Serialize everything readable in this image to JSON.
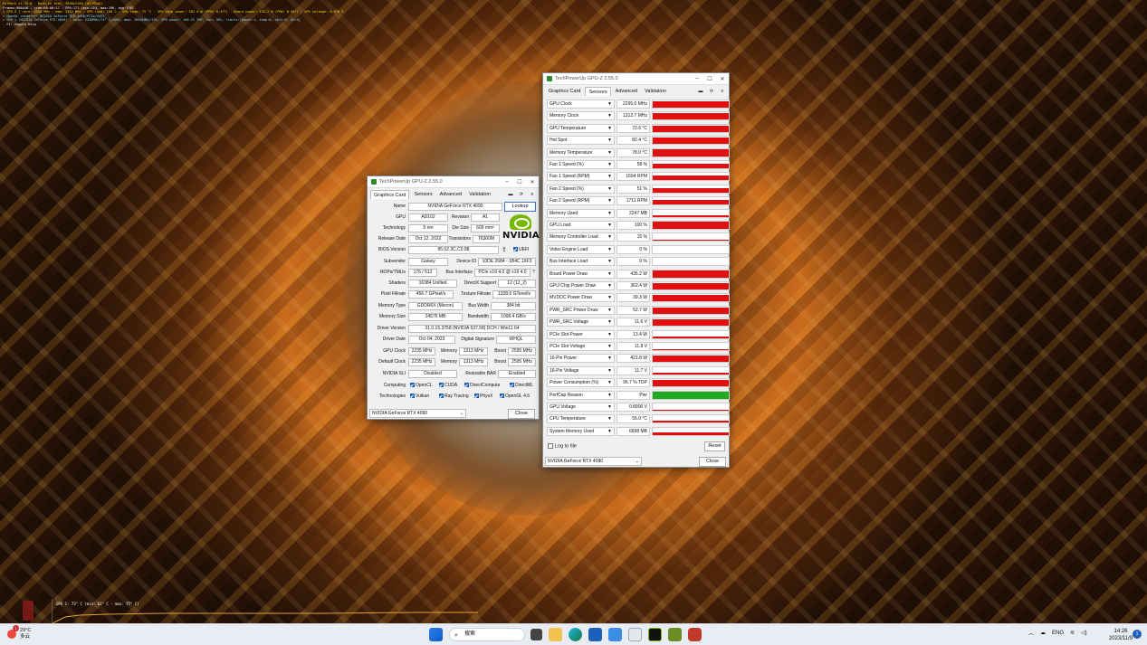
{
  "osd": {
    "lines": [
      "FurMark v1.35.0 - Burn-in test, 3840x2160 (0X MSAA)",
      "Frames:906448 - time:00:00:17 - FPS:177 (min:154, max:196, avg:176)",
      "[ GPU-Z ] core: 2250 MHz - mem: 1312 MHz - GPU load: 100 % - GPU temp: 73 °C - GPU chip power: 362.4 W (PPW: 0.477) - Board power: 435.2 W (PPW: 0.407) - GPU voltage: 0.870 V",
      "> OpenGL renderer: NVIDIA GeForce RTX 4090/PCIe/SSE2",
      "> GPU 1 (NVIDIA GeForce RTX 4090) - core: 2250MHz/74° C/100%, mem: 10501MHz/15%, GPU power: 100.2% TDP, fan: 58%, limits:[power:1, temp:0, volt:0, OV:0]",
      "- F1: toggle help"
    ]
  },
  "graph": {
    "label": "GPU 1: 73° C (min: 61° C - max: 75° C)"
  },
  "gc_window": {
    "title": "TechPowerUp GPU-Z 2.55.0",
    "tabs": [
      "Graphics Card",
      "Sensors",
      "Advanced",
      "Validation"
    ],
    "lookup": "Lookup",
    "logo_text": "NVIDIA",
    "uefi": "UEFI",
    "fields": {
      "name_l": "Name",
      "name": "NVIDIA GeForce RTX 4090",
      "gpu_l": "GPU",
      "gpu": "AD102",
      "rev_l": "Revision",
      "rev": "A1",
      "tech_l": "Technology",
      "tech": "5 nm",
      "die_l": "Die Size",
      "die": "609 mm²",
      "rel_l": "Release Date",
      "rel": "Oct 12, 2022",
      "trans_l": "Transistors",
      "trans": "76300M",
      "bios_l": "BIOS Version",
      "bios": "95.02.3C.C0.88",
      "subv_l": "Subvendor",
      "subv": "Galaxy",
      "dev_l": "Device ID",
      "dev": "10DE 2684 - 1B4C 16F3",
      "rops_l": "ROPs/TMUs",
      "rops": "176 / 512",
      "bus_l": "Bus Interface",
      "bus": "PCIe x16 4.0 @ x16 4.0",
      "q": "?",
      "shad_l": "Shaders",
      "shad": "16384 Unified",
      "dx_l": "DirectX Support",
      "dx": "12 (12_2)",
      "pix_l": "Pixel Fillrate",
      "pix": "456.7 GPixel/s",
      "tex_l": "Texture Fillrate",
      "tex": "1328.6 GTexel/s",
      "mt_l": "Memory Type",
      "mt": "GDDR6X (Micron)",
      "bw_l": "Bus Width",
      "bw": "384 bit",
      "ms_l": "Memory Size",
      "ms": "24576 MB",
      "band_l": "Bandwidth",
      "band": "1008.4 GB/s",
      "drv_l": "Driver Version",
      "drv": "31.0.15.3758 (NVIDIA 537.58) DCH / Win11 64",
      "dd_l": "Driver Date",
      "dd": "Oct 04, 2023",
      "sig_l": "Digital Signature",
      "sig": "WHQL",
      "gclk_l": "GPU Clock",
      "gclk": "2235 MHz",
      "mem_l": "Memory",
      "mem": "1313 MHz",
      "boost_l": "Boost",
      "boost": "2595 MHz",
      "dclk_l": "Default Clock",
      "dclk": "2235 MHz",
      "dmem": "1313 MHz",
      "dboost": "2595 MHz",
      "sli_l": "NVIDIA SLI",
      "sli": "Disabled",
      "rbar_l": "Resizable BAR",
      "rbar": "Enabled",
      "comp_l": "Computing",
      "opencl": "OpenCL",
      "cuda": "CUDA",
      "dcomp": "DirectCompute",
      "dml": "DirectML",
      "techs_l": "Technologies",
      "vulkan": "Vulkan",
      "rt": "Ray Tracing",
      "physx": "PhysX",
      "ogl": "OpenGL 4.6"
    },
    "device_select": "NVIDIA GeForce RTX 4090",
    "close": "Close"
  },
  "sn_window": {
    "title": "TechPowerUp GPU-Z 2.55.0",
    "tabs": [
      "Graphics Card",
      "Sensors",
      "Advanced",
      "Validation"
    ],
    "sensors": [
      {
        "name": "GPU Clock",
        "value": "2295.0 MHz",
        "level": 0.9
      },
      {
        "name": "Memory Clock",
        "value": "1312.7 MHz",
        "level": 0.9
      },
      {
        "name": "GPU Temperature",
        "value": "72.6 °C",
        "level": 0.9
      },
      {
        "name": "Hot Spot",
        "value": "82.4 °C",
        "level": 0.9
      },
      {
        "name": "Memory Temperature",
        "value": "78.0 °C",
        "level": 0.9
      },
      {
        "name": "Fan 1 Speed (%)",
        "value": "58 %",
        "level": 0.65
      },
      {
        "name": "Fan 1 Speed (RPM)",
        "value": "1694 RPM",
        "level": 0.65
      },
      {
        "name": "Fan 2 Speed (%)",
        "value": "51 %",
        "level": 0.6
      },
      {
        "name": "Fan 2 Speed (RPM)",
        "value": "1711 RPM",
        "level": 0.6
      },
      {
        "name": "Memory Used",
        "value": "2247 MB",
        "level": 0.1
      },
      {
        "name": "GPU Load",
        "value": "100 %",
        "level": 0.95
      },
      {
        "name": "Memory Controller Load",
        "value": "15 %",
        "level": 0.15
      },
      {
        "name": "Video Engine Load",
        "value": "0 %",
        "level": 0
      },
      {
        "name": "Bus Interface Load",
        "value": "0 %",
        "level": 0
      },
      {
        "name": "Board Power Draw",
        "value": "435.2 W",
        "level": 0.9
      },
      {
        "name": "GPU Chip Power Draw",
        "value": "362.4 W",
        "level": 0.9
      },
      {
        "name": "MVDDC Power Draw",
        "value": "39.3 W",
        "level": 0.9
      },
      {
        "name": "PWR_SRC Power Draw",
        "value": "52.7 W",
        "level": 0.9
      },
      {
        "name": "PWR_SRC Voltage",
        "value": "11.6 V",
        "level": 0.9
      },
      {
        "name": "PCIe Slot Power",
        "value": "13.4 W",
        "level": 0.15
      },
      {
        "name": "PCIe Slot Voltage",
        "value": "11.8 V",
        "level": 0.15
      },
      {
        "name": "16-Pin Power",
        "value": "421.8 W",
        "level": 0.9
      },
      {
        "name": "16-Pin Voltage",
        "value": "11.7 V",
        "level": 0.15
      },
      {
        "name": "Power Consumption (%)",
        "value": "96.7 % TDP",
        "level": 0.9
      },
      {
        "name": "PerfCap Reason",
        "value": "Pwr",
        "level": 1,
        "color": "#1faa1f"
      },
      {
        "name": "GPU Voltage",
        "value": "0.8900 V",
        "level": 0.15
      },
      {
        "name": "CPU Temperature",
        "value": "55.0 °C",
        "level": 0.35
      },
      {
        "name": "System Memory Used",
        "value": "6698 MB",
        "level": 0.3
      }
    ],
    "log": "Log to file",
    "reset": "Reset",
    "device_select": "NVIDIA GeForce RTX 4090",
    "close": "Close"
  },
  "taskbar": {
    "weather_temp": "29°C",
    "weather_desc": "多云",
    "weather_badge": "1",
    "search": "搜索",
    "lang": "ENG",
    "time": "14:26",
    "date": "2023/11/9",
    "notifications": "1"
  },
  "colors": {
    "sensor_bar": "#e01010",
    "perfcap": "#1faa1f",
    "nvidia": "#76b900"
  }
}
